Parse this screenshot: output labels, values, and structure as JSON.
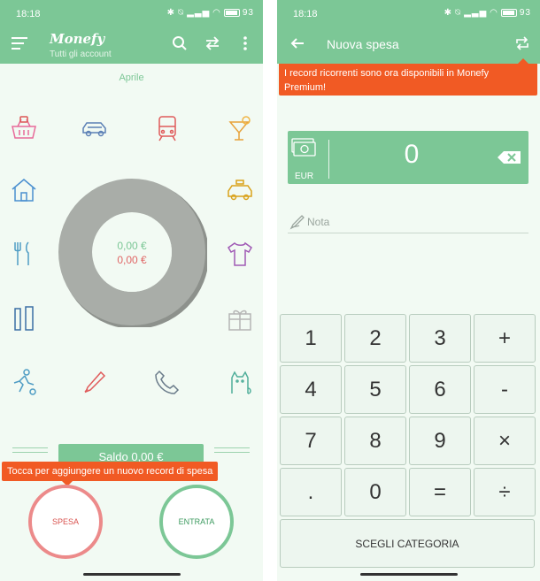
{
  "status_bar": {
    "time": "18:18",
    "battery": "93"
  },
  "left": {
    "app_title": "Monefy",
    "app_subtitle": "Tutti gli account",
    "month": "Aprile",
    "expense_total": "0,00 €",
    "income_total": "0,00 €",
    "balance": "Saldo 0,00 €",
    "tooltip": "Tocca per aggiungere un nuovo record di spesa",
    "expense_button": "SPESA",
    "income_button": "ENTRATA",
    "categories": [
      "basket-icon",
      "car-icon",
      "train-icon",
      "cocktail-icon",
      "house-icon",
      "taxi-icon",
      "cutlery-icon",
      "tshirt-icon",
      "toiletries-icon",
      "gift-icon",
      "sports-icon",
      "thermometer-icon",
      "phone-icon",
      "cat-icon"
    ]
  },
  "right": {
    "screen_title": "Nuova spesa",
    "premium_notice": "I record ricorrenti sono ora disponibili in Monefy Premium!",
    "amount": "0",
    "currency": "EUR",
    "note_placeholder": "Nota",
    "keys": [
      "1",
      "2",
      "3",
      "+",
      "4",
      "5",
      "6",
      "-",
      "7",
      "8",
      "9",
      "×",
      ".",
      "0",
      "=",
      "÷"
    ],
    "choose_category": "SCEGLI CATEGORIA"
  },
  "colors": {
    "green": "#7cc796",
    "red": "#e06666",
    "orange": "#f15a24",
    "donut": "#a9ada8"
  }
}
